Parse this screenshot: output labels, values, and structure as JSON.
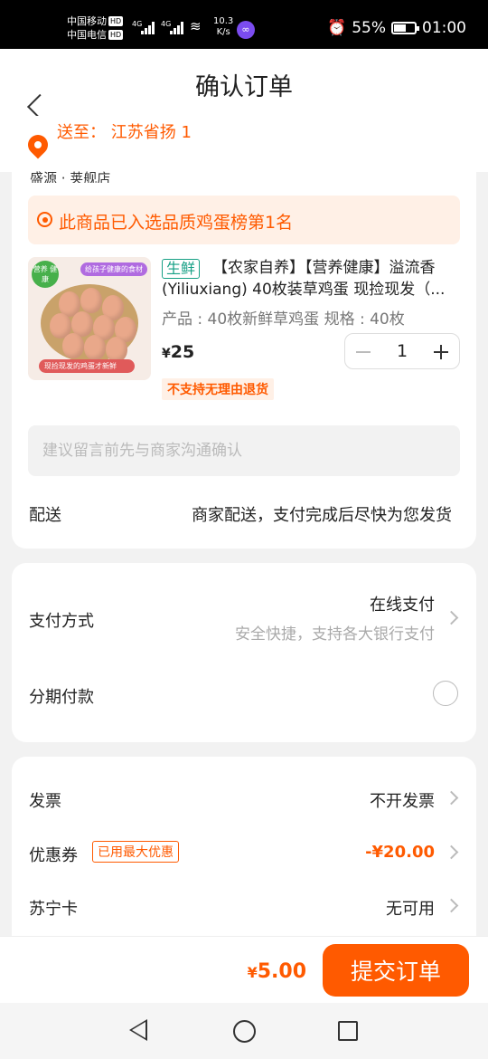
{
  "status_bar": {
    "carrier1": "中国移动",
    "carrier2": "中国电信",
    "hd": "HD",
    "net1": "4G",
    "net2": "4G",
    "speed_value": "10.3",
    "speed_unit": "K/s",
    "battery": "55%",
    "time": "01:00"
  },
  "header": {
    "title": "确认订单"
  },
  "address": {
    "text": "送至： 江苏省扬 1"
  },
  "store": {
    "name": "盛源 · 荚舰店"
  },
  "banner": {
    "text": "此商品已入选品质鸡蛋榜第1名"
  },
  "product": {
    "image_tag_left": "营养 健康",
    "image_tag_right": "给孩子健康的食材",
    "image_tag_bottom": "现捡现发的鸡蛋才新鲜",
    "fresh_tag": "生鲜",
    "title": "【农家自养】【营养健康】溢流香(Yiliuxiang) 40枚装草鸡蛋 现捡现发（...",
    "spec": "产品 : 40枚新鲜草鸡蛋  规格 : 40枚",
    "price_symbol": "¥",
    "price": "25",
    "quantity": "1",
    "no_return": "不支持无理由退货"
  },
  "message": {
    "placeholder": "建议留言前先与商家沟通确认"
  },
  "delivery": {
    "label": "配送",
    "value": "商家配送，支付完成后尽快为您发货"
  },
  "payment": {
    "label": "支付方式",
    "value": "在线支付",
    "sub": "安全快捷，支持各大银行支付",
    "installment_label": "分期付款"
  },
  "invoice": {
    "label": "发票",
    "value": "不开发票"
  },
  "coupon": {
    "label": "优惠券",
    "tag": "已用最大优惠",
    "value": "-¥20.00"
  },
  "suning_card": {
    "label": "苏宁卡",
    "value": "无可用"
  },
  "bottom": {
    "total_symbol": "¥",
    "total": "5.00",
    "submit": "提交订单"
  },
  "colors": {
    "accent": "#ff5a00",
    "fresh": "#16a085"
  }
}
